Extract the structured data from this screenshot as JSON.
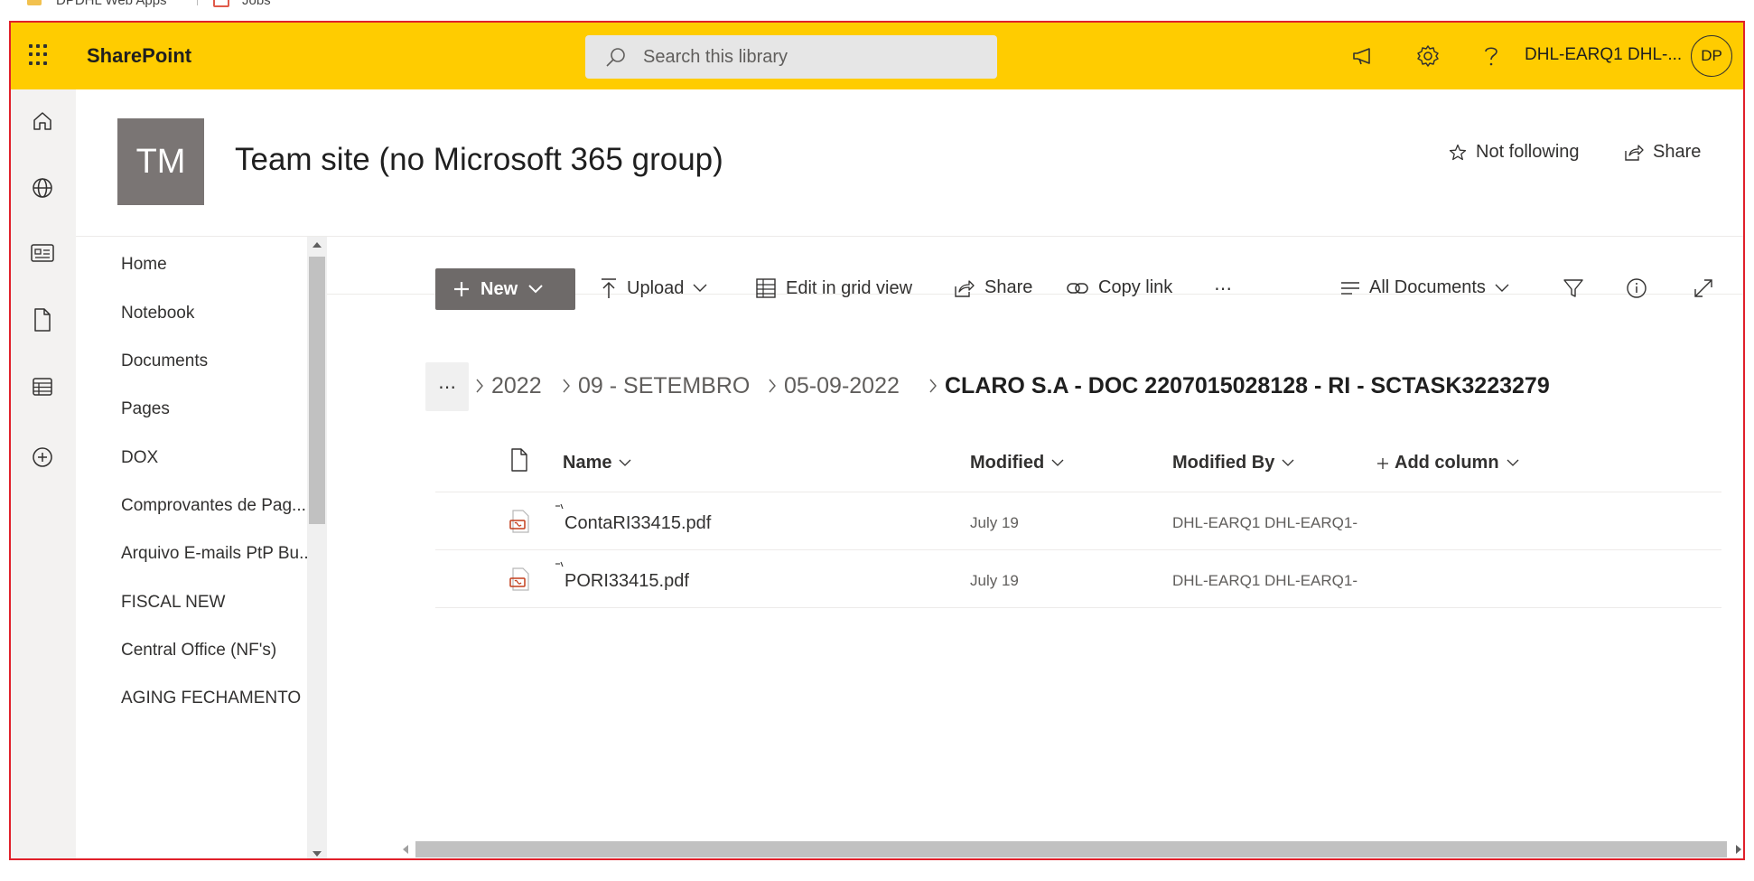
{
  "browser": {
    "bookmarks": [
      {
        "label": "DPDHL Web Apps",
        "icon": "folder-icon"
      },
      {
        "label": "Jobs",
        "icon": "office-icon"
      }
    ]
  },
  "suitebar": {
    "brand": "SharePoint",
    "search_placeholder": "Search this library",
    "user_name": "DHL-EARQ1 DHL-...",
    "avatar_initials": "DP",
    "accent_color": "#ffcc00"
  },
  "site": {
    "logo_initials": "TM",
    "title": "Team site (no Microsoft 365 group)",
    "follow_label": "Not following",
    "share_label": "Share"
  },
  "nav": {
    "items": [
      "Home",
      "Notebook",
      "Documents",
      "Pages",
      "DOX",
      "Comprovantes de Pag...",
      "Arquivo E-mails PtP Bu...",
      "FISCAL NEW",
      "Central Office (NF's)",
      "AGING FECHAMENTO"
    ]
  },
  "commands": {
    "new": "New",
    "upload": "Upload",
    "grid": "Edit in grid view",
    "share": "Share",
    "copy_link": "Copy link",
    "more": "⋯",
    "view": "All Documents"
  },
  "breadcrumb": {
    "more": "⋯",
    "items": [
      "2022",
      "09 - SETEMBRO",
      "05-09-2022"
    ],
    "current": "CLARO S.A - DOC 2207015028128 - RI - SCTASK3223279"
  },
  "list": {
    "columns": {
      "name": "Name",
      "modified": "Modified",
      "modified_by": "Modified By",
      "add_column": "Add column"
    },
    "rows": [
      {
        "name": "ContaRI33415.pdf",
        "modified": "July 19",
        "modified_by": "DHL-EARQ1 DHL-EARQ1-"
      },
      {
        "name": "PORI33415.pdf",
        "modified": "July 19",
        "modified_by": "DHL-EARQ1 DHL-EARQ1-"
      }
    ]
  }
}
